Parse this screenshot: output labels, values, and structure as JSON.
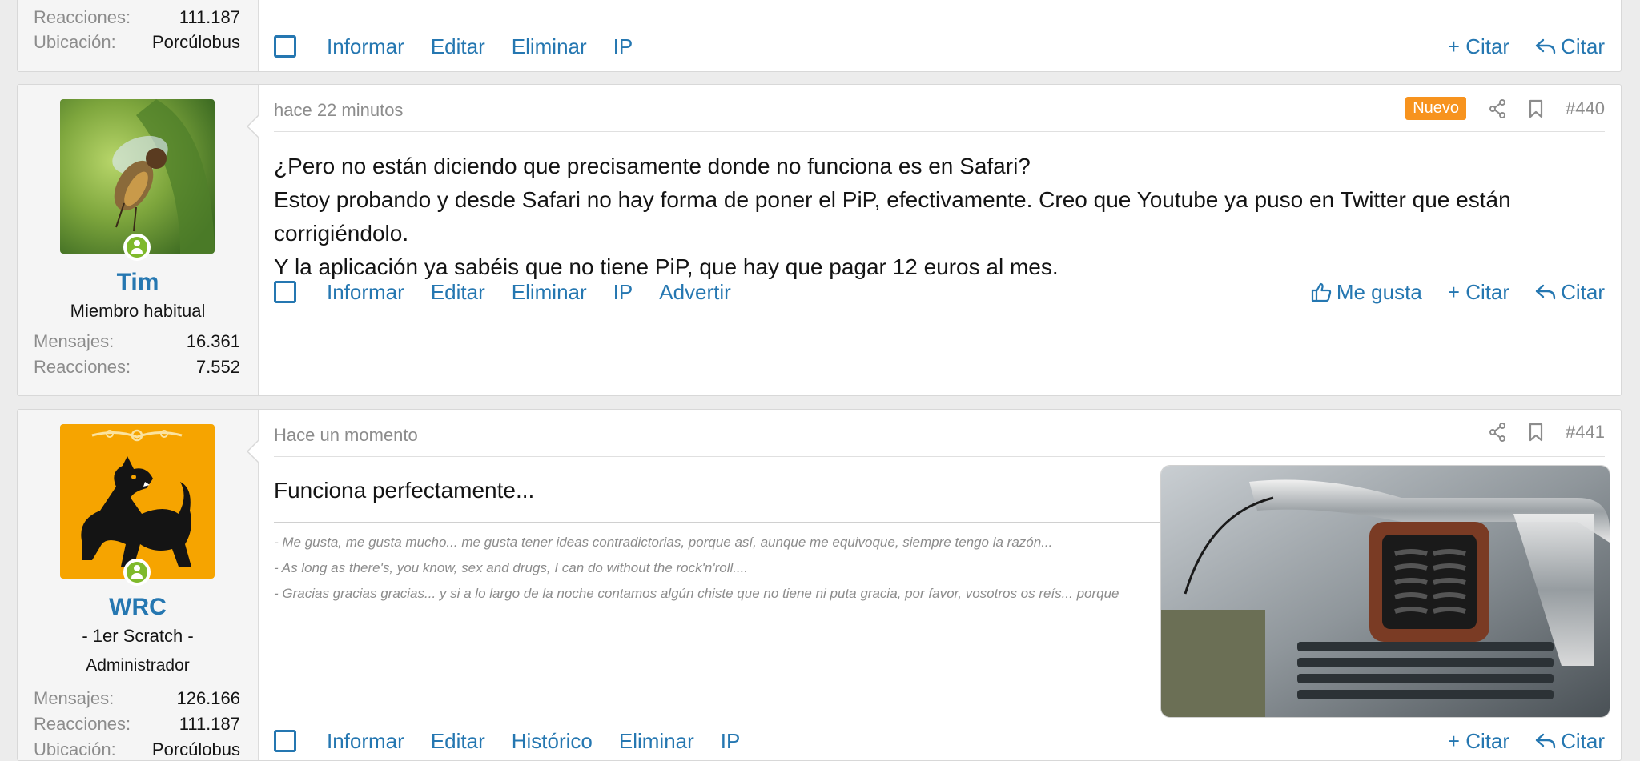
{
  "posts": [
    {
      "stats": [
        {
          "label": "Reacciones:",
          "value": "111.187"
        },
        {
          "label": "Ubicación:",
          "value": "Porcúlobus"
        }
      ],
      "actions_left": [
        "Informar",
        "Editar",
        "Eliminar",
        "IP"
      ],
      "actions_right": {
        "multiquote": "+ Citar",
        "reply": "Citar"
      }
    },
    {
      "username": "Tim",
      "user_title": "Miembro habitual",
      "stats": [
        {
          "label": "Mensajes:",
          "value": "16.361"
        },
        {
          "label": "Reacciones:",
          "value": "7.552"
        }
      ],
      "time": "hace 22 minutos",
      "badge": "Nuevo",
      "post_number": "#440",
      "body": [
        "¿Pero no están diciendo que precisamente donde no funciona es en Safari?",
        "Estoy probando y desde Safari no hay forma de poner el PiP, efectivamente. Creo que Youtube ya puso en Twitter que están corrigiéndolo.",
        "Y la aplicación ya sabéis que no tiene PiP, que hay que pagar 12 euros al mes."
      ],
      "actions_left": [
        "Informar",
        "Editar",
        "Eliminar",
        "IP",
        "Advertir"
      ],
      "actions_right": {
        "like": "Me gusta",
        "multiquote": "+ Citar",
        "reply": "Citar"
      }
    },
    {
      "username": "WRC",
      "user_title": "- 1er Scratch -",
      "user_banner": "Administrador",
      "stats": [
        {
          "label": "Mensajes:",
          "value": "126.166"
        },
        {
          "label": "Reacciones:",
          "value": "111.187"
        },
        {
          "label": "Ubicación:",
          "value": "Porcúlobus"
        }
      ],
      "time": "Hace un momento",
      "post_number": "#441",
      "body": [
        "Funciona perfectamente..."
      ],
      "signature": [
        "- Me gusta, me gusta mucho... me gusta tener ideas contradictorias, porque así, aunque me equivoque, siempre tengo la razón...",
        "- As long as there's, you know, sex and drugs, I can do without the rock'n'roll....",
        "- Gracias gracias gracias... y si a lo largo de la noche contamos algún chiste que no tiene ni puta gracia, por favor, vosotros os reís... porque"
      ],
      "actions_left": [
        "Informar",
        "Editar",
        "Histórico",
        "Eliminar",
        "IP"
      ],
      "actions_right": {
        "multiquote": "+ Citar",
        "reply": "Citar"
      }
    }
  ],
  "colors": {
    "link": "#2577b1",
    "badge": "#f7931e",
    "online": "#7fb92b",
    "muted": "#8c8c8c"
  },
  "icons": [
    "share-icon",
    "bookmark-icon",
    "thumbs-up-icon",
    "reply-icon",
    "online-status-icon"
  ]
}
